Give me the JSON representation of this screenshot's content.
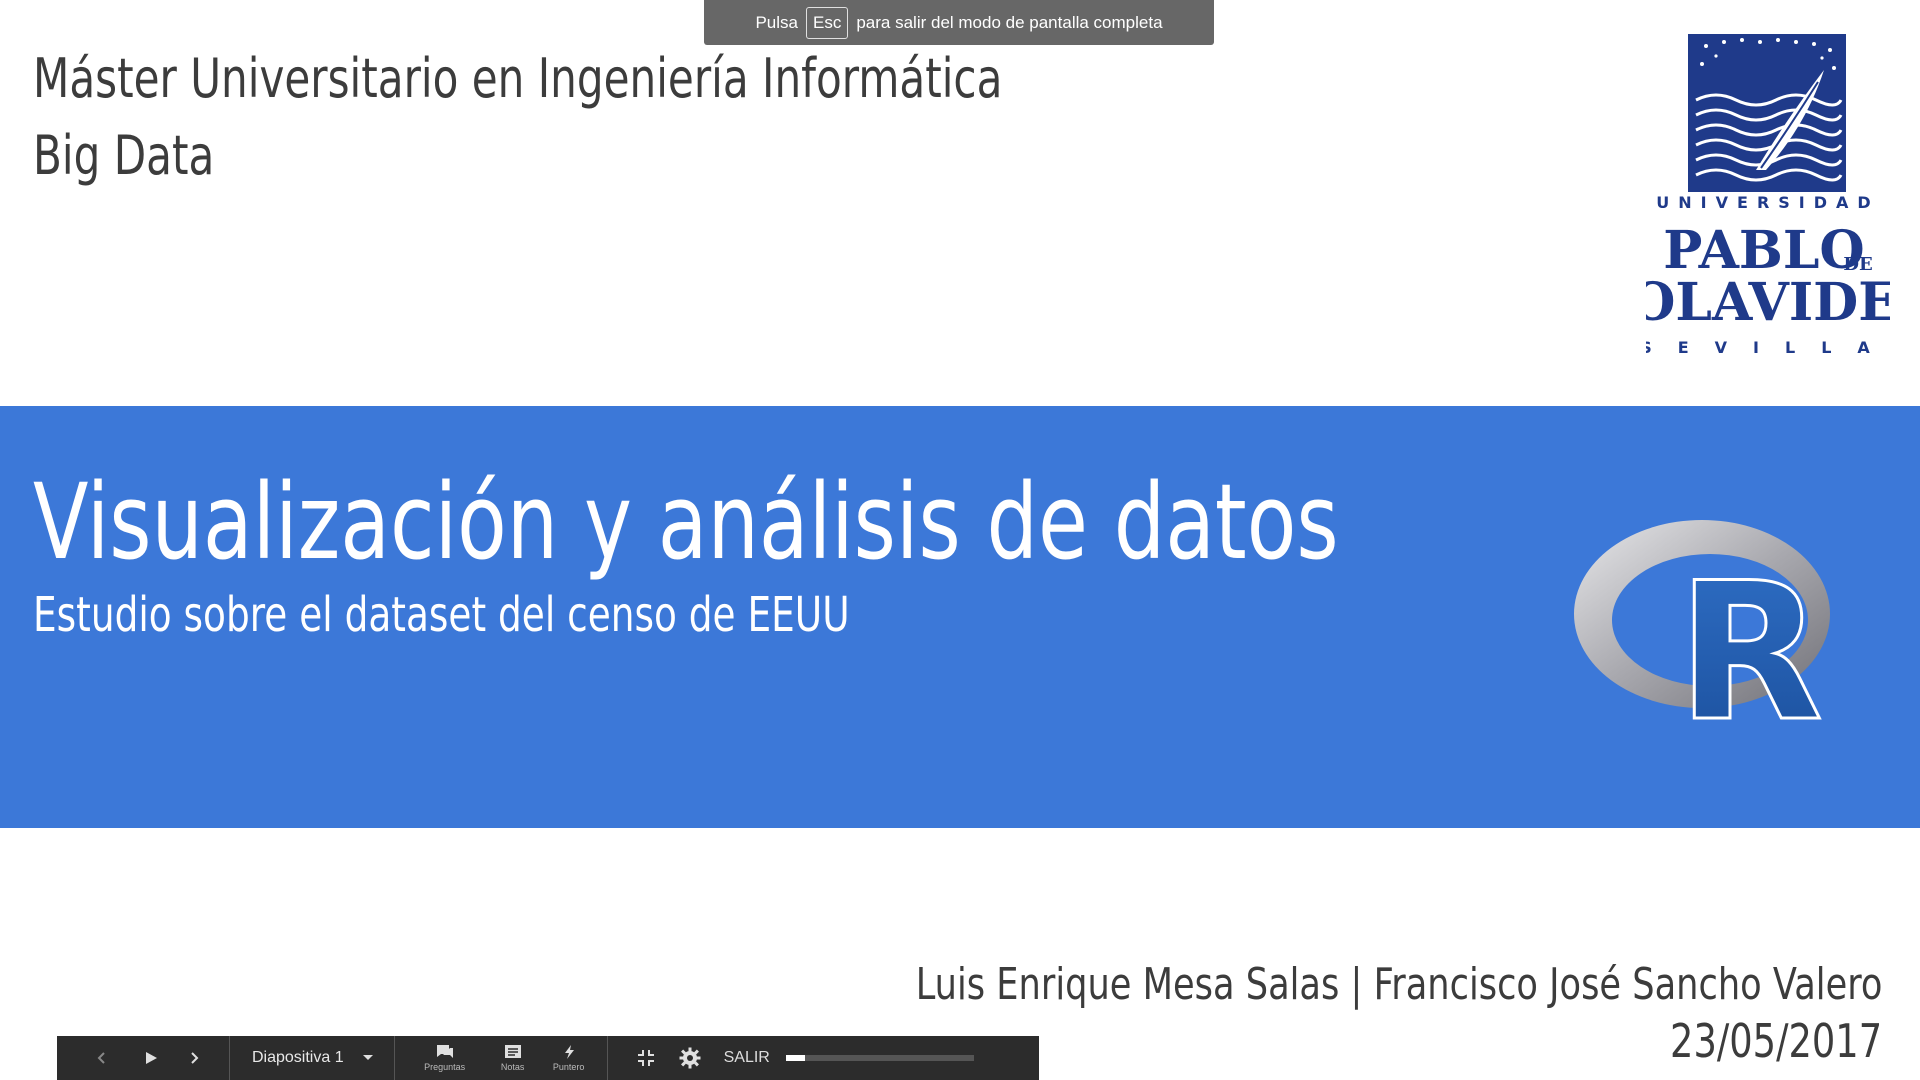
{
  "notice": {
    "prefix": "Pulsa",
    "key": "Esc",
    "suffix": "para salir del modo de pantalla completa"
  },
  "slide": {
    "program_line1": "Máster Universitario en Ingeniería Informática",
    "program_line2": "Big Data",
    "title": "Visualización y análisis de datos",
    "subtitle": "Estudio sobre el dataset del censo de EEUU",
    "authors": "Luis Enrique Mesa Salas | Francisco José Sancho Valero",
    "date": "23/05/2017",
    "band_color": "#3c78d8",
    "logo_upo": {
      "top_text": "UNIVERSIDAD",
      "name_line1": "PABLO",
      "name_de": "DE",
      "name_line2": "OLAVIDE",
      "city": "SEVILLA"
    },
    "logo_r": {
      "letter": "R"
    }
  },
  "toolbar": {
    "prev_icon": "chevron-left-icon",
    "play_icon": "play-icon",
    "next_icon": "chevron-right-icon",
    "slide_label": "Diapositiva 1",
    "questions_label": "Preguntas",
    "notes_label": "Notas",
    "pointer_label": "Puntero",
    "exit_fullscreen_icon": "exit-fullscreen-icon",
    "settings_icon": "gear-icon",
    "exit_label": "SALIR",
    "progress_fraction": 0.1
  }
}
